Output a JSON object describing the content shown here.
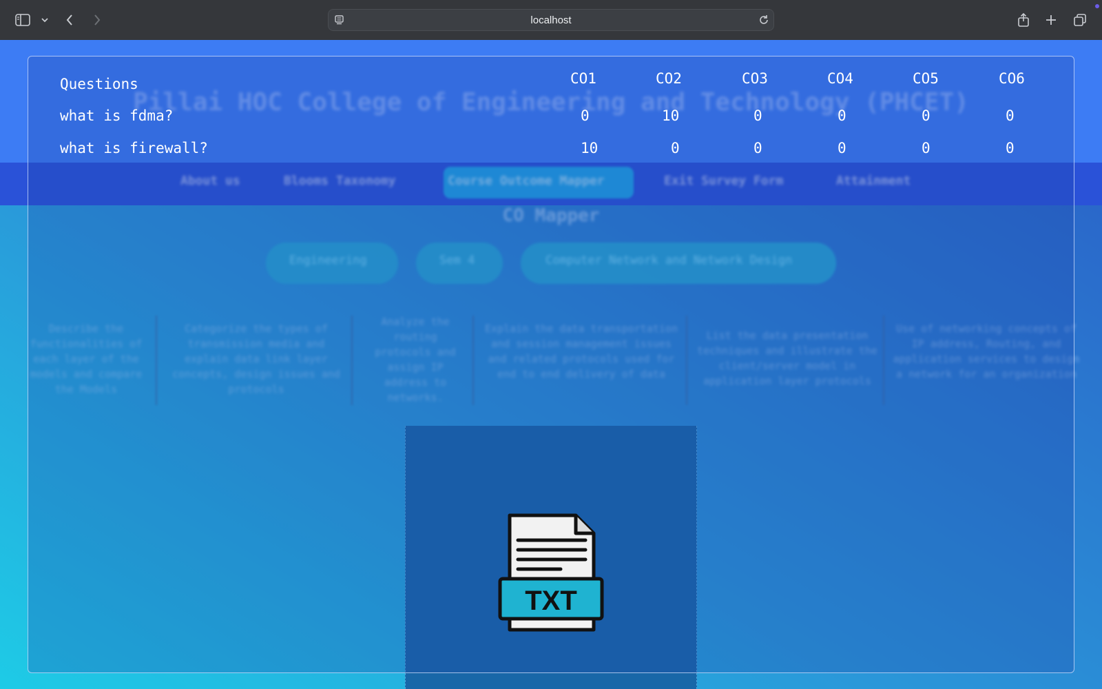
{
  "browser": {
    "url": "localhost",
    "icons": [
      "sidebar-icon",
      "chevron-down-icon",
      "back-icon",
      "forward-icon",
      "site-icon",
      "reload-icon",
      "share-icon",
      "new-tab-icon",
      "tabs-icon"
    ]
  },
  "background_page": {
    "college_title": "Pillai HOC College of Engineering and Technology (PHCET)",
    "nav": [
      "About us",
      "Blooms Taxonomy",
      "Course Outcome Mapper",
      "Exit Survey Form",
      "Attainment"
    ],
    "active_nav": "Course Outcome Mapper",
    "section_title": "CO Mapper",
    "filters": [
      "Engineering",
      "Sem 4",
      "Computer Network and Network Design"
    ],
    "course_outcomes": [
      "Describe the functionalities of each layer of the models and compare the Models",
      "Categorize the types of transmission media and explain data link layer concepts, design issues and protocols",
      "Analyze the routing protocols and assign IP address to networks.",
      "Explain the data transportation and session management issues and related protocols used for end to end delivery of data",
      "List the data presentation techniques and illustrate the client/server model in application layer protocols",
      "Use of networking concepts of IP address, Routing, and application services to design a network for an organization"
    ],
    "colors": {
      "band": "#3d7cf4",
      "nav": "#2a52d8",
      "active": "#1fa3e6"
    }
  },
  "table": {
    "header": {
      "question": "Questions",
      "cos": [
        "CO1",
        "CO2",
        "CO3",
        "CO4",
        "CO5",
        "CO6"
      ]
    },
    "rows": [
      {
        "question": "what is fdma?",
        "values": [
          "0",
          "10",
          "0",
          "0",
          "0",
          "0"
        ]
      },
      {
        "question": "what is firewall?",
        "values": [
          "10",
          "0",
          "0",
          "0",
          "0",
          "0"
        ]
      }
    ]
  },
  "file_icon": {
    "name": "txt-file-icon",
    "label": "TXT"
  }
}
